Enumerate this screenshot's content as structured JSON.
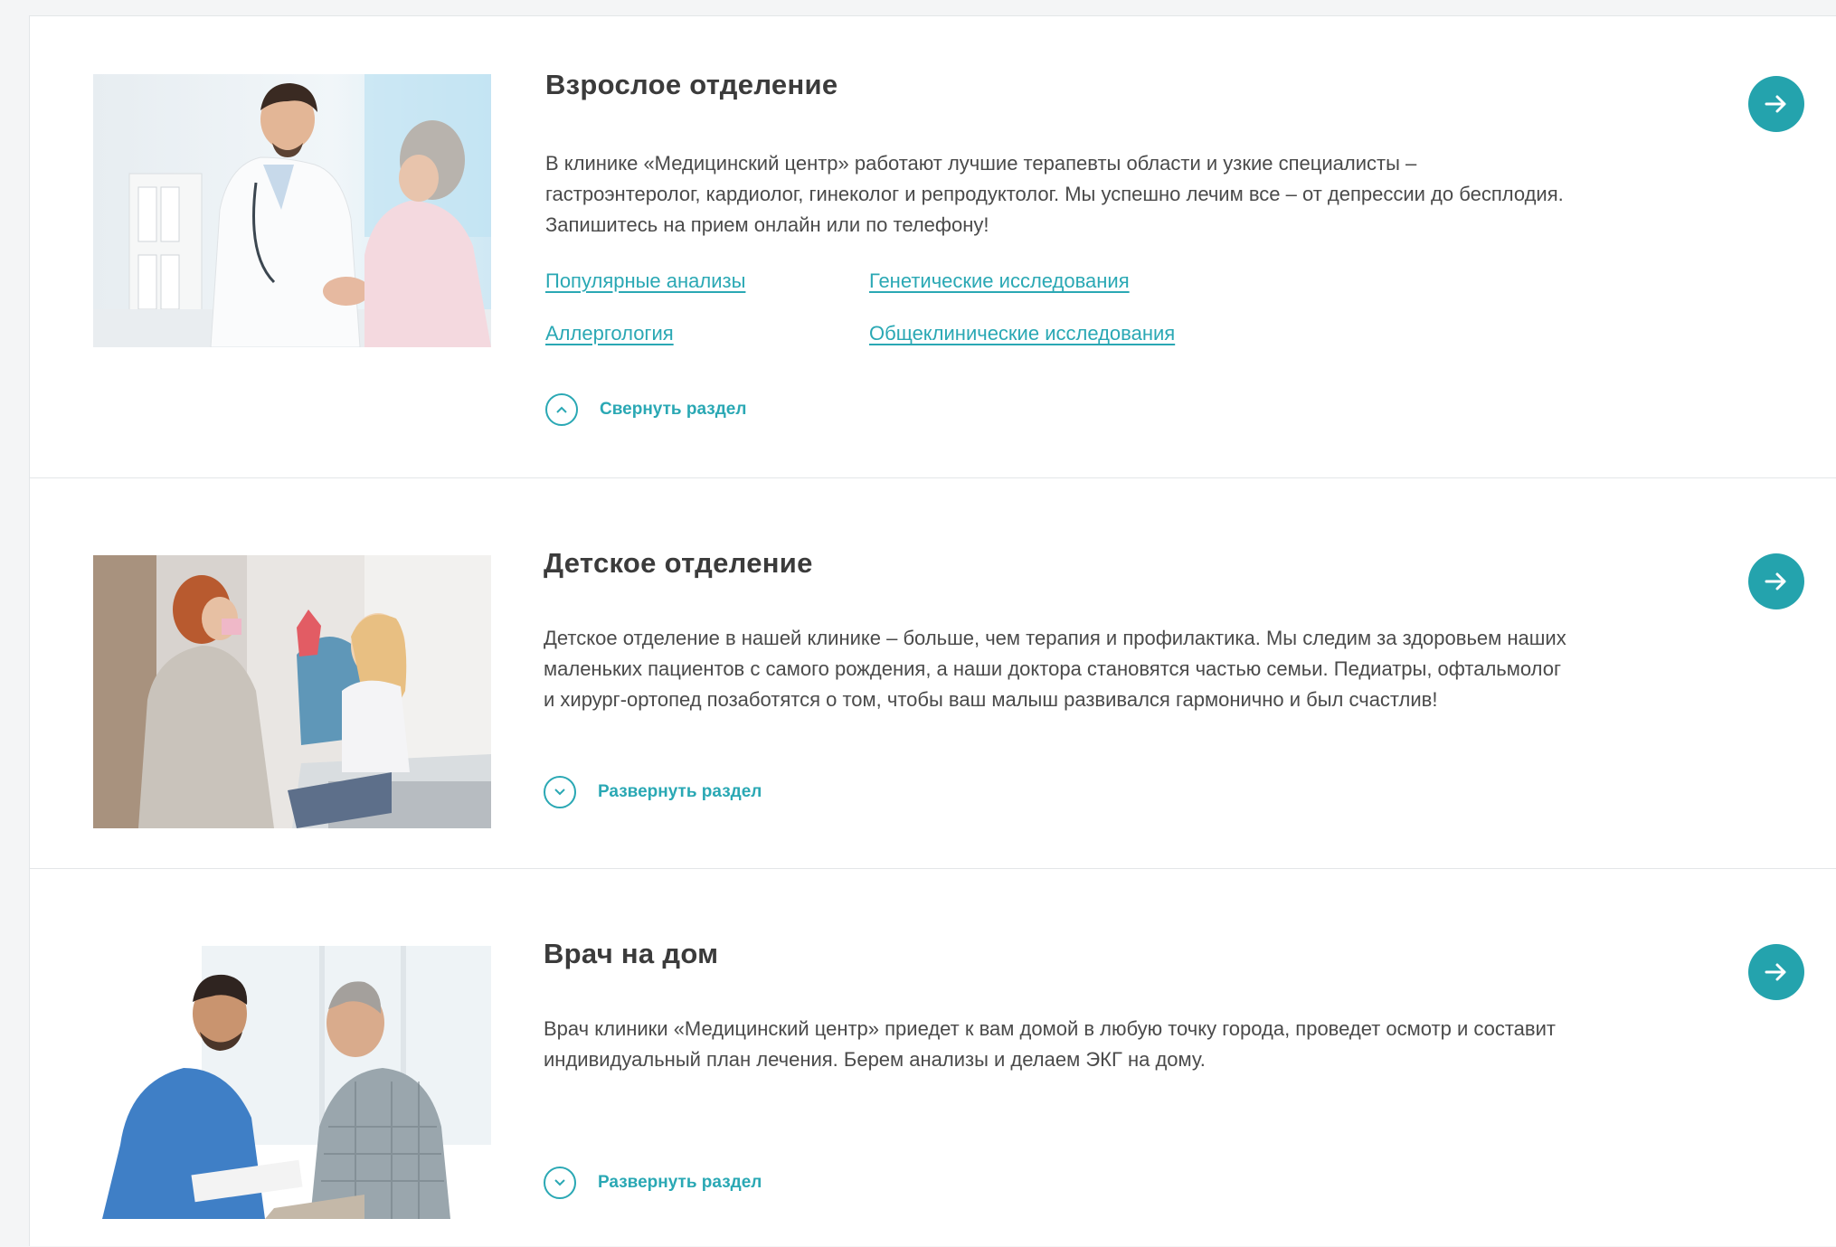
{
  "sections": [
    {
      "title": "Взрослое отделение",
      "description": "В клинике «Медицинский центр» работают лучшие терапевты области и узкие специалисты – гастроэнтеролог, кардиолог, гинеколог и репродуктолог. Мы успешно лечим все – от депрессии до бесплодия. Запишитесь на прием онлайн или по телефону!",
      "links": [
        "Популярные анализы",
        "Генетические исследования",
        "Аллергология",
        "Общеклинические исследования"
      ],
      "toggle_label": "Свернуть раздел",
      "toggle_icon": "chevron-up-icon",
      "image": "doctor-greeting-elderly-patient",
      "expanded": true
    },
    {
      "title": "Детское отделение",
      "description": "Детское отделение в нашей клинике – больше, чем терапия и профилактика. Мы следим за здоровьем наших маленьких пациентов с самого рождения, а наши доктора становятся частью семьи. Педиатры, офтальмолог и хирург-ортопед позаботятся о том, чтобы ваш малыш развивался гармонично и был счастлив!",
      "toggle_label": "Развернуть раздел",
      "toggle_icon": "chevron-down-icon",
      "image": "dentist-high-five-child",
      "expanded": false
    },
    {
      "title": "Врач на дом",
      "description": "Врач клиники «Медицинский центр» приедет к вам домой в любую точку города, проведет осмотр и составит индивидуальный план лечения. Берем анализы и делаем ЭКГ на дому.",
      "toggle_label": "Развернуть раздел",
      "toggle_icon": "chevron-down-icon",
      "image": "doctor-visiting-elderly-man",
      "expanded": false
    }
  ],
  "colors": {
    "accent": "#2aa8b4",
    "button": "#24a3ad",
    "title": "#3b3b3b",
    "text": "#4a4a4a",
    "border": "#e3e6e8"
  },
  "icons": {
    "go_button": "arrow-right-icon"
  }
}
